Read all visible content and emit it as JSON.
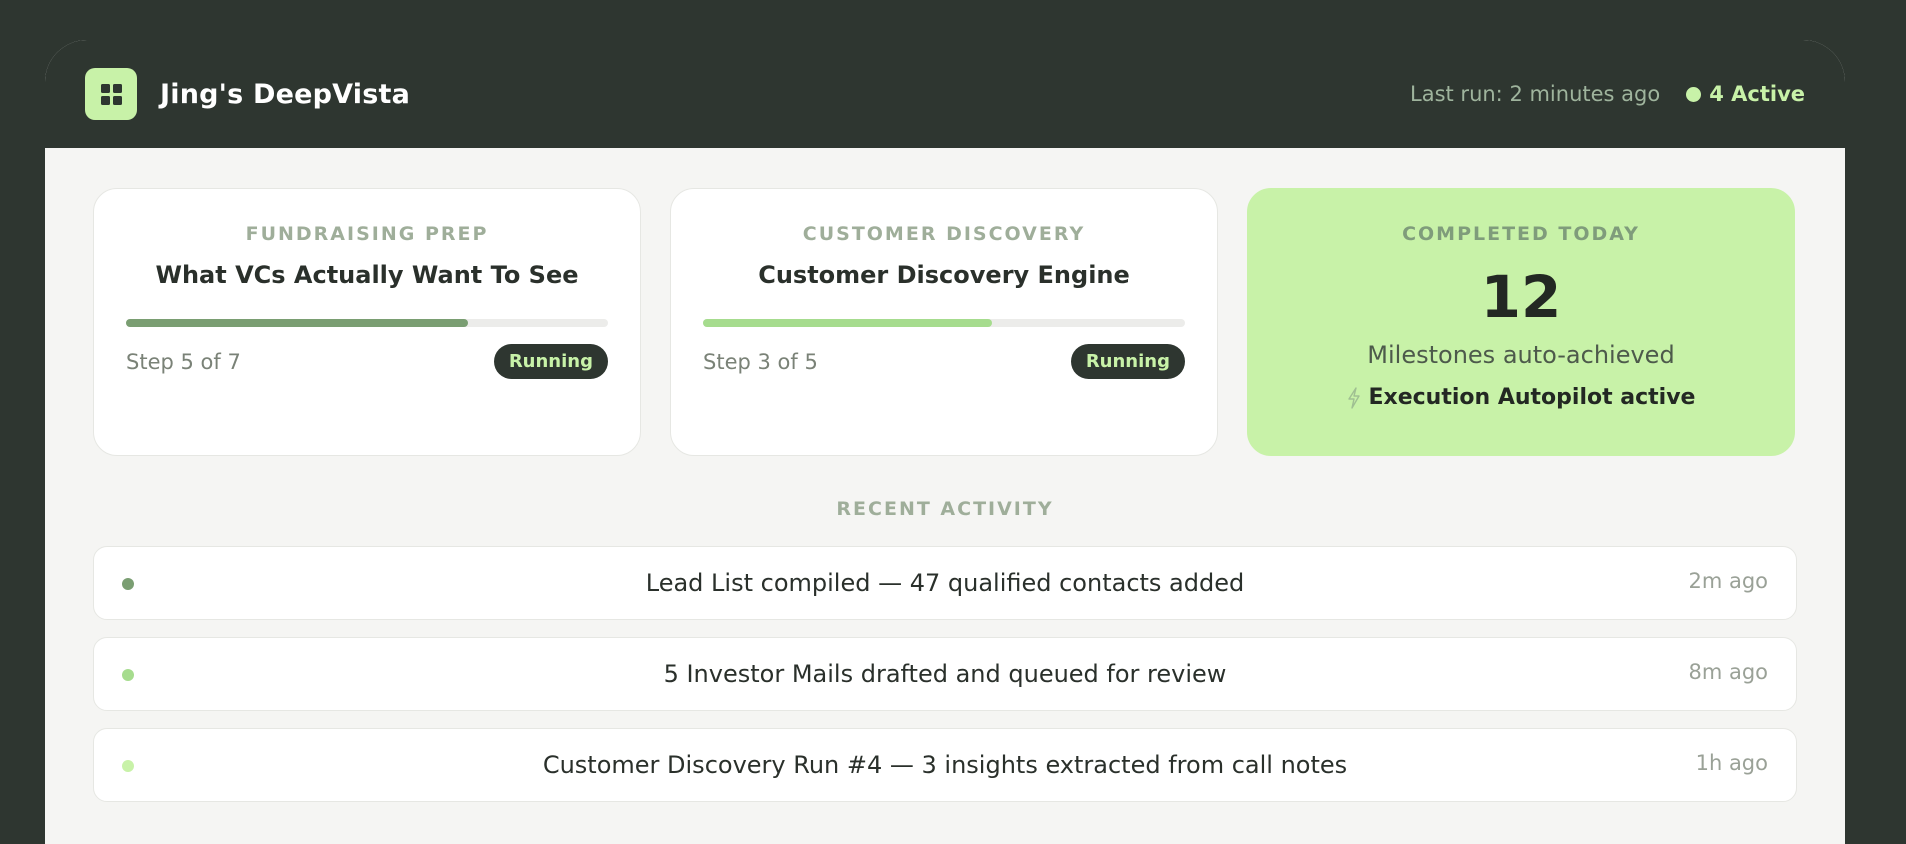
{
  "header": {
    "app_title": "Jing's DeepVista",
    "last_run": "Last run: 2 minutes ago",
    "active_label": "4 Active",
    "logo_icon": "grid-icon"
  },
  "colors": {
    "dark": "#2e3630",
    "accent": "#c8f2a8",
    "progress_dark": "#7a9e72",
    "progress_light": "#a6dc8e"
  },
  "workflows": [
    {
      "category": "FUNDRAISING PREP",
      "title": "What VCs Actually Want To See",
      "step": "Step 5 of 7",
      "progress": 0.71,
      "status": "Running",
      "progress_color": "#7a9e72"
    },
    {
      "category": "CUSTOMER DISCOVERY",
      "title": "Customer Discovery Engine",
      "step": "Step 3 of 5",
      "progress": 0.6,
      "status": "Running",
      "progress_color": "#a6dc8e"
    }
  ],
  "summary": {
    "label": "COMPLETED TODAY",
    "count": "12",
    "subtitle": "Milestones auto-achieved",
    "autopilot": "Execution Autopilot active",
    "autopilot_icon": "lightning-bolt-icon"
  },
  "recent_activity": {
    "label": "RECENT ACTIVITY",
    "items": [
      {
        "text": "Lead List compiled — 47 qualified contacts added",
        "time": "2m ago",
        "dot_color": "#7a9e72"
      },
      {
        "text": "5 Investor Mails drafted and queued for review",
        "time": "8m ago",
        "dot_color": "#a6dc8e"
      },
      {
        "text": "Customer Discovery Run #4 — 3 insights extracted from call notes",
        "time": "1h ago",
        "dot_color": "#c8f2a8"
      }
    ]
  }
}
